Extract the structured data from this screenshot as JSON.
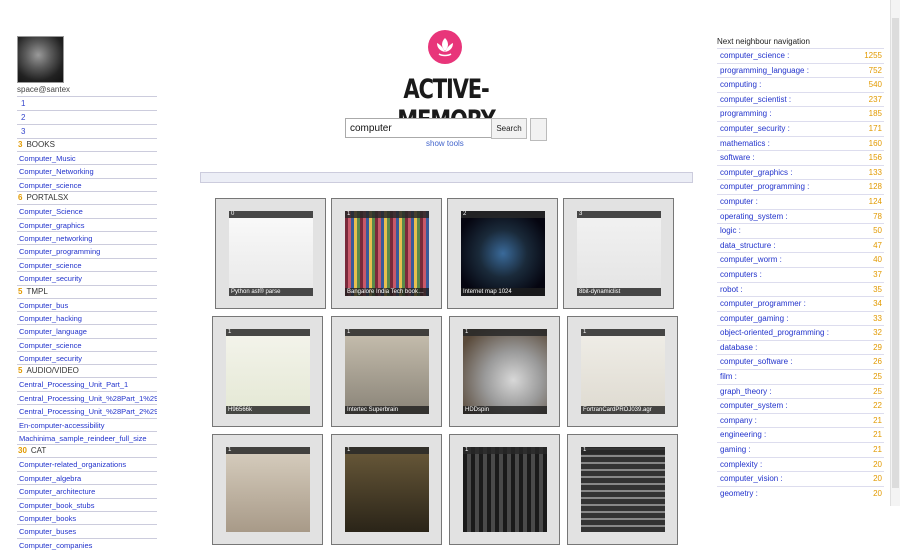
{
  "user": {
    "name": "space@santex"
  },
  "left_numbers": [
    "1",
    "2",
    "3"
  ],
  "groups": [
    {
      "count": "3",
      "name": "BOOKS",
      "items": [
        "Computer_Music",
        "Computer_Networking",
        "Computer_science"
      ]
    },
    {
      "count": "6",
      "name": "PORTALSX",
      "items": [
        "Computer_Science",
        "Computer_graphics",
        "Computer_networking",
        "Computer_programming",
        "Computer_science",
        "Computer_security"
      ]
    },
    {
      "count": "5",
      "name": "TMPL",
      "items": [
        "Computer_bus",
        "Computer_hacking",
        "Computer_language",
        "Computer_science",
        "Computer_security"
      ]
    },
    {
      "count": "5",
      "name": "AUDIO/VIDEO",
      "items": [
        "Central_Processing_Unit_Part_1",
        "Central_Processing_Unit_%28Part_1%29",
        "Central_Processing_Unit_%28Part_2%29",
        "En-computer-accessibility",
        "Machinima_sample_reindeer_full_size"
      ]
    },
    {
      "count": "30",
      "name": "CAT",
      "items": [
        "Computer-related_organizations",
        "Computer_algebra",
        "Computer_architecture",
        "Computer_book_stubs",
        "Computer_books",
        "Computer_buses",
        "Computer_companies"
      ]
    }
  ],
  "logo": {
    "text": "ACTIVE-MEMORY",
    "icon": "lotus-icon",
    "color": "#e8357a"
  },
  "search": {
    "value": "computer",
    "button": "Search",
    "show_tools": "show tools"
  },
  "tiles": [
    {
      "idx": "0",
      "caption": "Python ast® parse"
    },
    {
      "idx": "1",
      "caption": "Bangalore India Tech book…"
    },
    {
      "idx": "2",
      "caption": "Internet map 1024"
    },
    {
      "idx": "3",
      "caption": "8bit-dynamiclist"
    },
    {
      "idx": "1",
      "caption": "H96566k"
    },
    {
      "idx": "1",
      "caption": "Intertec Superbrain"
    },
    {
      "idx": "1",
      "caption": "HDDspin"
    },
    {
      "idx": "1",
      "caption": "FortranCardPROJ039.agr"
    },
    {
      "idx": "1",
      "caption": ""
    },
    {
      "idx": "1",
      "caption": ""
    },
    {
      "idx": "1",
      "caption": ""
    },
    {
      "idx": "1",
      "caption": ""
    }
  ],
  "right": {
    "title": "Next neighbour navigation",
    "items": [
      {
        "label": "computer_science :",
        "value": "1255"
      },
      {
        "label": "programming_language :",
        "value": "752"
      },
      {
        "label": "computing :",
        "value": "540"
      },
      {
        "label": "computer_scientist :",
        "value": "237"
      },
      {
        "label": "programming :",
        "value": "185"
      },
      {
        "label": "computer_security :",
        "value": "171"
      },
      {
        "label": "mathematics :",
        "value": "160"
      },
      {
        "label": "software :",
        "value": "156"
      },
      {
        "label": "computer_graphics :",
        "value": "133"
      },
      {
        "label": "computer_programming :",
        "value": "128"
      },
      {
        "label": "computer :",
        "value": "124"
      },
      {
        "label": "operating_system :",
        "value": "78"
      },
      {
        "label": "logic :",
        "value": "50"
      },
      {
        "label": "data_structure :",
        "value": "47"
      },
      {
        "label": "computer_worm :",
        "value": "40"
      },
      {
        "label": "computers :",
        "value": "37"
      },
      {
        "label": "robot :",
        "value": "35"
      },
      {
        "label": "computer_programmer :",
        "value": "34"
      },
      {
        "label": "computer_gaming :",
        "value": "33"
      },
      {
        "label": "object-oriented_programming :",
        "value": "32"
      },
      {
        "label": "database :",
        "value": "29"
      },
      {
        "label": "computer_software :",
        "value": "26"
      },
      {
        "label": "film :",
        "value": "25"
      },
      {
        "label": "graph_theory :",
        "value": "25"
      },
      {
        "label": "computer_system :",
        "value": "22"
      },
      {
        "label": "company :",
        "value": "21"
      },
      {
        "label": "engineering :",
        "value": "21"
      },
      {
        "label": "gaming :",
        "value": "21"
      },
      {
        "label": "complexity :",
        "value": "20"
      },
      {
        "label": "computer_vision :",
        "value": "20"
      },
      {
        "label": "geometry :",
        "value": "20"
      }
    ]
  }
}
